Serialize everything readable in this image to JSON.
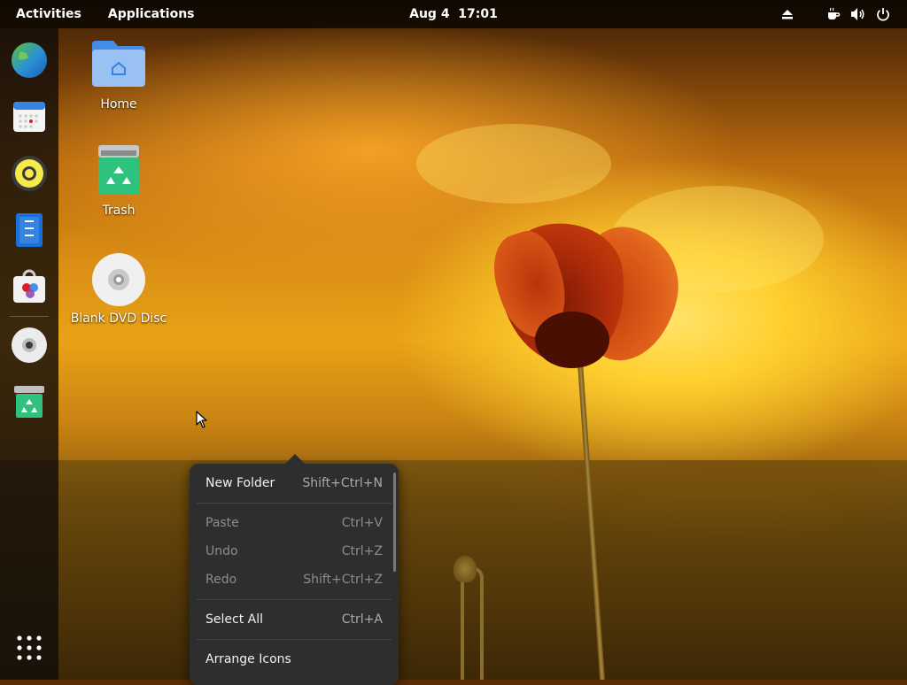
{
  "topbar": {
    "activities": "Activities",
    "applications": "Applications",
    "clock": "Aug 4  17:01",
    "tray_icons": [
      "eject-icon",
      "coffee-icon",
      "volume-icon",
      "power-icon"
    ]
  },
  "dock": {
    "items": [
      "browser-icon",
      "calendar-icon",
      "music-player-icon",
      "notes-icon",
      "software-store-icon",
      "disc-icon",
      "trash-icon"
    ],
    "show_apps": "app-grid-icon"
  },
  "desktop": {
    "icons": [
      {
        "label": "Home",
        "icon": "home-folder-icon"
      },
      {
        "label": "Trash",
        "icon": "trash-icon"
      },
      {
        "label": "Blank DVD Disc",
        "icon": "dvd-disc-icon"
      }
    ]
  },
  "context_menu": {
    "items": [
      {
        "label": "New Folder",
        "shortcut": "Shift+Ctrl+N",
        "enabled": true
      },
      {
        "label": "Paste",
        "shortcut": "Ctrl+V",
        "enabled": false
      },
      {
        "label": "Undo",
        "shortcut": "Ctrl+Z",
        "enabled": false
      },
      {
        "label": "Redo",
        "shortcut": "Shift+Ctrl+Z",
        "enabled": false
      },
      {
        "label": "Select All",
        "shortcut": "Ctrl+A",
        "enabled": true
      },
      {
        "label": "Arrange Icons",
        "shortcut": "",
        "enabled": true
      }
    ]
  },
  "colors": {
    "topbar_bg": "#000000",
    "menu_bg": "#2e2e2e",
    "accent_blue": "#3584e4",
    "wallpaper_sun": "#ffcf2e"
  }
}
